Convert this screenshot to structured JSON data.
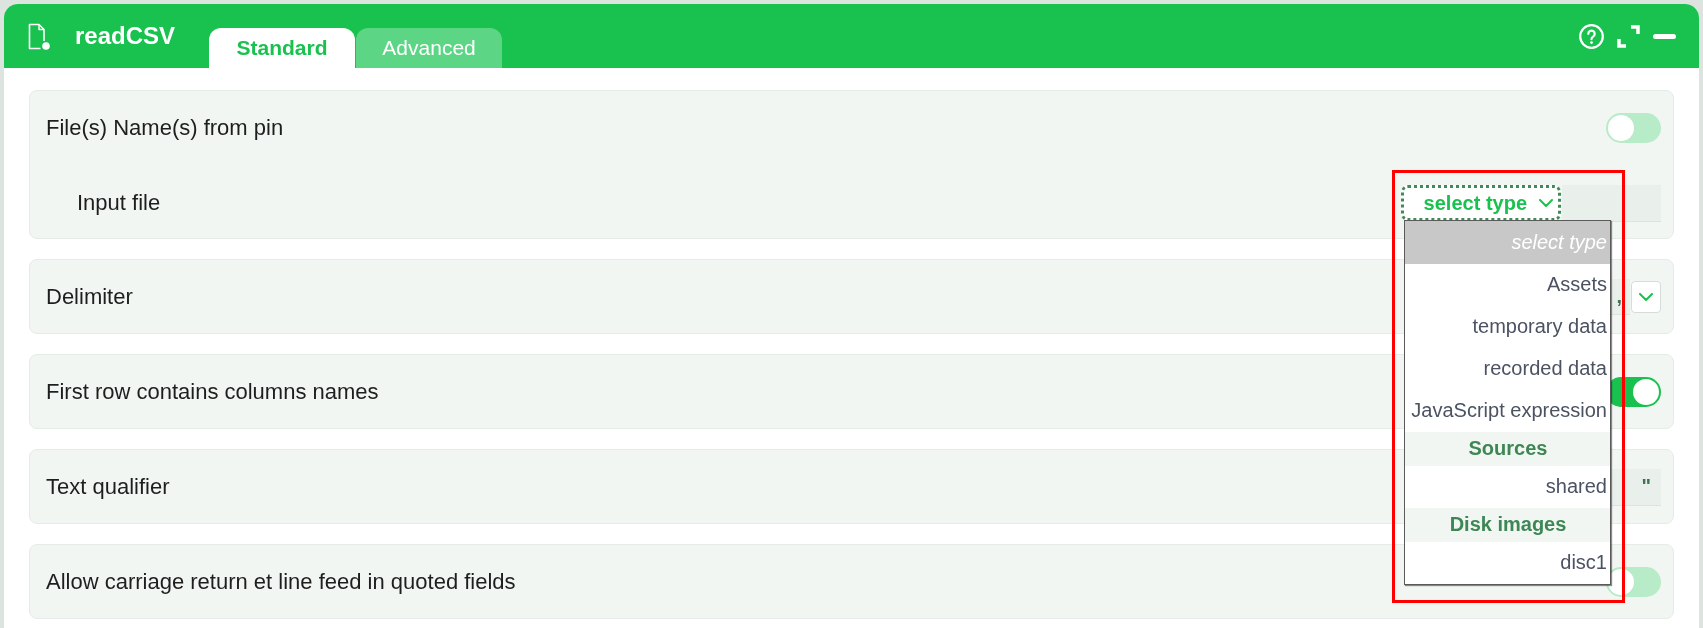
{
  "window": {
    "title": "readCSV"
  },
  "tabs": [
    {
      "label": "Standard",
      "selected": true
    },
    {
      "label": "Advanced",
      "selected": false
    }
  ],
  "settings": [
    {
      "kind": "toggle",
      "label": "File(s) Name(s) from pin",
      "on": false,
      "sub": {
        "label": "Input file",
        "select": {
          "label": "select type",
          "expanded": true,
          "options": [
            {
              "kind": "placeholder",
              "label": "select type",
              "selected": true
            },
            {
              "kind": "option",
              "label": "Assets",
              "selected": false
            },
            {
              "kind": "option",
              "label": "temporary data",
              "selected": false
            },
            {
              "kind": "option",
              "label": "recorded data",
              "selected": false
            },
            {
              "kind": "option",
              "label": "JavaScript expression",
              "selected": false
            },
            {
              "kind": "group",
              "label": "Sources",
              "selected": false
            },
            {
              "kind": "option",
              "label": "shared",
              "selected": false
            },
            {
              "kind": "group",
              "label": "Disk images",
              "selected": false
            },
            {
              "kind": "option",
              "label": "disc1",
              "selected": false
            }
          ]
        }
      }
    },
    {
      "kind": "select",
      "label": "Delimiter",
      "value": ","
    },
    {
      "kind": "toggle",
      "label": "First row contains columns names",
      "on": true
    },
    {
      "kind": "text",
      "label": "Text qualifier",
      "value": "\""
    },
    {
      "kind": "toggle",
      "label": "Allow carriage return et line feed in quoted fields",
      "on": false
    }
  ]
}
